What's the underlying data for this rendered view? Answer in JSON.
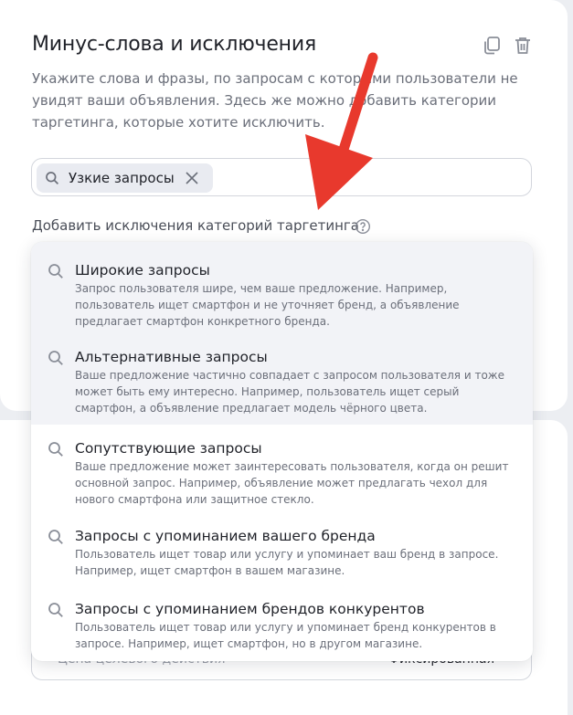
{
  "section": {
    "title": "Минус-слова и исключения",
    "description": "Укажите слова и фразы, по запросам с которыми пользователи не увидят ваши объявления. Здесь же можно добавить категории таргетинга, которые хотите исключить.",
    "icons": [
      "copy-icon",
      "trash-icon"
    ]
  },
  "exclusions_field": {
    "chips": [
      {
        "label": "Узкие запросы",
        "icon": "search-icon",
        "remove_icon": "close-icon"
      }
    ]
  },
  "add_exclusions": {
    "label": "Добавить исключения категорий таргетинга",
    "help_icon": "question-circle-icon"
  },
  "dropdown": {
    "options": [
      {
        "title": "Широкие запросы",
        "description": "Запрос пользователя шире, чем ваше предложение. Например, пользователь ищет смартфон и не уточняет бренд, а объявление предлагает смартфон конкретного бренда.",
        "highlighted": true
      },
      {
        "title": "Альтернативные запросы",
        "description": "Ваше предложение частично совпадает с запросом пользователя и тоже может быть ему интересно. Например, пользователь ищет серый смартфон, а объявление предлагает модель чёрного цвета.",
        "highlighted": true
      },
      {
        "title": "Сопутствующие запросы",
        "description": "Ваше предложение может заинтересовать пользователя, когда он решит основной запрос. Например, объявление может предлагать чехол для нового смартфона или защитное стекло.",
        "highlighted": false
      },
      {
        "title": "Запросы с упоминанием вашего бренда",
        "description": "Пользователь ищет товар или услугу и упоминает ваш бренд в запросе. Например, ищет смартфон в вашем магазине.",
        "highlighted": false
      },
      {
        "title": "Запросы с упоминанием брендов конкурентов",
        "description": "Пользователь ищет товар или услугу и упоминает бренд конкурентов в запросе. Например, ищет смартфон, но в другом магазине.",
        "highlighted": false
      }
    ]
  },
  "background_field": {
    "left_text": "Цена целевого действия",
    "right_text": "Фиксированная"
  },
  "colors": {
    "arrow": "#e8392d",
    "highlight": "#f2f3f7",
    "chip": "#e9ebf1"
  }
}
